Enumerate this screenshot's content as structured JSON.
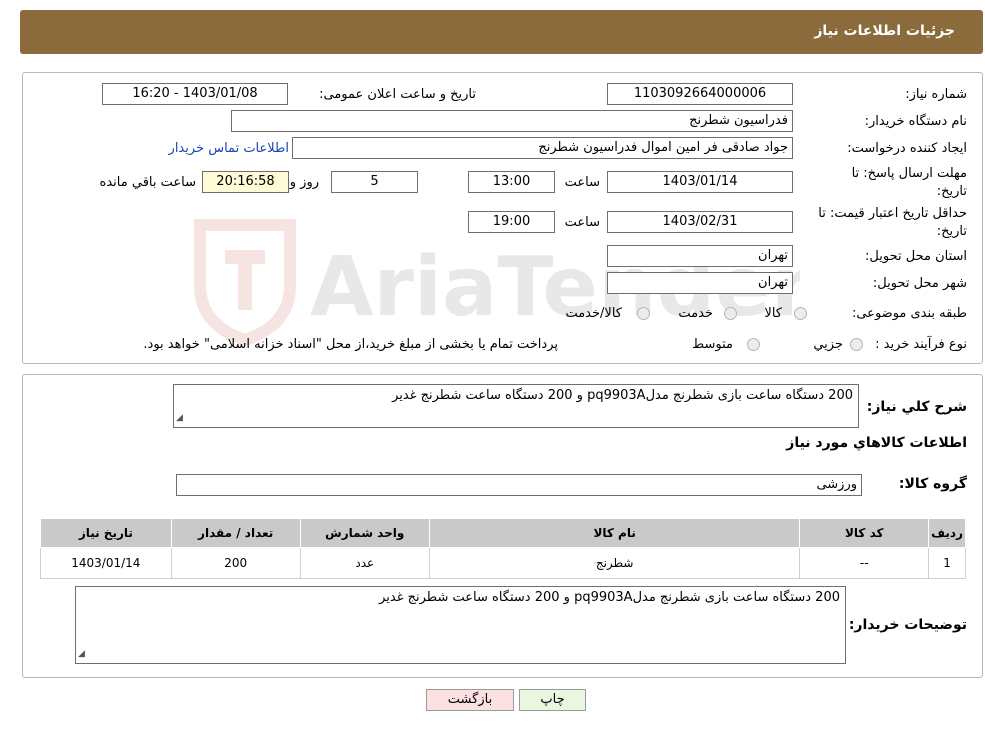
{
  "header": {
    "title": "جزئیات اطلاعات نیاز"
  },
  "form": {
    "need_number_label": "شماره نیاز:",
    "need_number": "1103092664000006",
    "announce_label": "تاریخ و ساعت اعلان عمومی:",
    "announce_value": "1403/01/08 - 16:20",
    "buyer_org_label": "نام دستگاه خریدار:",
    "buyer_org": "فدراسیون شطرنج",
    "creator_label": "ایجاد کننده درخواست:",
    "creator": "جواد صادقی فر امین اموال فدراسیون شطرنج",
    "contact_link": "اطلاعات تماس خریدار",
    "deadline_label_1": "مهلت ارسال پاسخ: تا",
    "deadline_label_2": "تاریخ:",
    "deadline_date": "1403/01/14",
    "time_label": "ساعت",
    "deadline_time": "13:00",
    "days_value": "5",
    "days_label": "روز و",
    "remaining_time": "20:16:58",
    "remaining_label": "ساعت باقي مانده",
    "validity_label_1": "حداقل تاریخ اعتبار قیمت: تا",
    "validity_label_2": "تاریخ:",
    "validity_date": "1403/02/31",
    "validity_time": "19:00",
    "province_label": "استان محل تحویل:",
    "province": "تهران",
    "city_label": "شهر محل تحویل:",
    "city": "تهران",
    "category_label": "طبقه بندی موضوعی:",
    "category_options": [
      "کالا",
      "خدمت",
      "کالا/خدمت"
    ],
    "process_label": "نوع فرآیند خرید :",
    "process_options": [
      "جزيي",
      "متوسط"
    ],
    "process_note": "پرداخت تمام یا بخشی از مبلغ خرید،از محل \"اسناد خزانه اسلامی\" خواهد بود."
  },
  "details": {
    "summary_label": "شرح کلي نياز:",
    "summary": "200 دستگاه ساعت  بازی شطرنج مدلpq9903A و  200 دستگاه ساعت شطرنج غدیر",
    "goods_title": "اطلاعات کالاهاي مورد نياز",
    "group_label": "گروه کالا:",
    "group_value": "ورزشی",
    "table": {
      "headers": [
        "رديف",
        "کد کالا",
        "نام کالا",
        "واحد شمارش",
        "تعداد / مقدار",
        "تاریخ نیاز"
      ],
      "rows": [
        [
          "1",
          "--",
          "شطرنج",
          "عدد",
          "200",
          "1403/01/14"
        ]
      ]
    },
    "buyer_notes_label": "توضيحات خريدار:",
    "buyer_notes": "200 دستگاه ساعت  بازی شطرنج مدلpq9903A و  200 دستگاه ساعت شطرنج غدیر"
  },
  "buttons": {
    "print": "چاپ",
    "back": "بازگشت"
  },
  "watermark": {
    "text": "AriaTender.neT"
  }
}
